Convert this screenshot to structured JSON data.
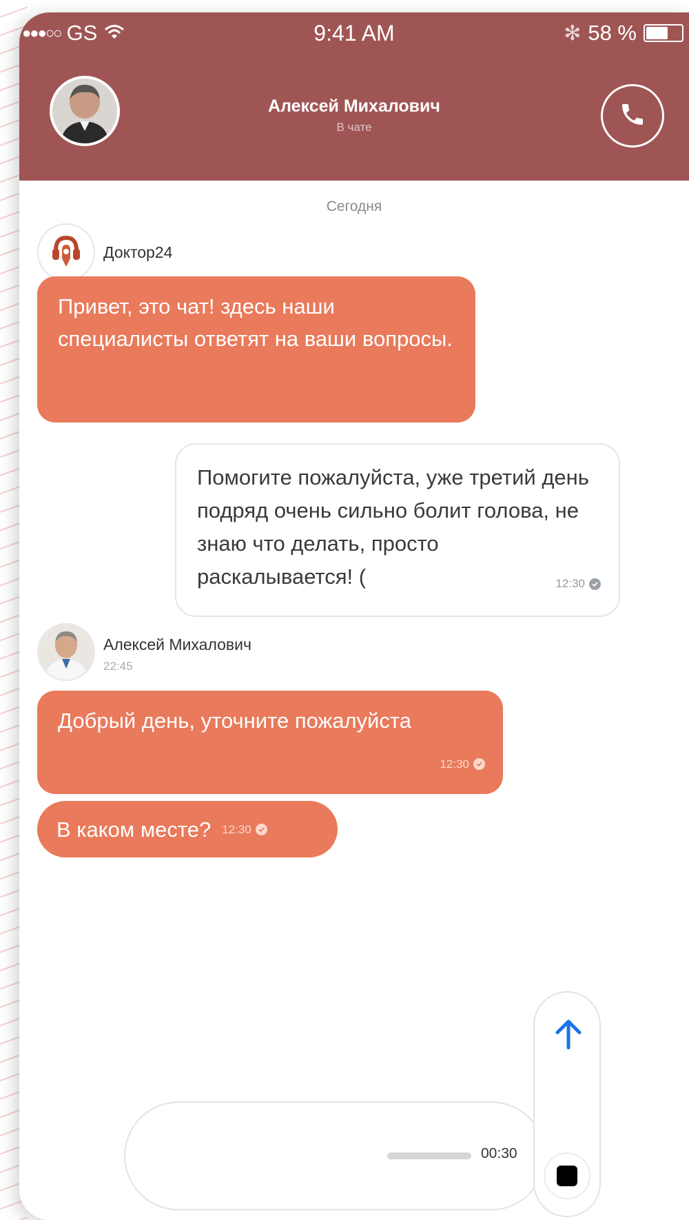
{
  "status_bar": {
    "signal_dots": "●●●○○",
    "carrier": "GS",
    "time": "9:41 AM",
    "battery_text": "58 %",
    "battery_level": 0.58
  },
  "header": {
    "contact_name": "Алексей Михалович",
    "contact_status": "В чате",
    "call_icon": "phone-icon",
    "avatar_icon": "avatar"
  },
  "chat": {
    "day_separator": "Сегодня",
    "bot_sender": {
      "name": "Доктор24",
      "icon": "headset-logo-icon"
    },
    "bot_message": "Привет, это чат! здесь  наши специалисты ответят на ваши вопросы.",
    "user_message": {
      "text": "Помогите пожалуйста, уже третий день подряд очень сильно болит голова, не знаю что делать, просто раскалывается! (",
      "time": "12:30"
    },
    "doctor_sender": {
      "name": "Алексей Михалович",
      "time": "22:45"
    },
    "doctor_messages": [
      {
        "text": "Добрый день, уточните пожалуйста",
        "time": "12:30"
      },
      {
        "text": "В каком месте?",
        "time": "12:30"
      }
    ]
  },
  "composer": {
    "recording_time": "00:30",
    "recording_progress": 0.0,
    "send_icon": "arrow-up-icon",
    "stop_icon": "stop-icon"
  },
  "colors": {
    "header_bg": "#a05555",
    "bubble_in": "#e97a5b",
    "accent_blue": "#1a73e8"
  }
}
